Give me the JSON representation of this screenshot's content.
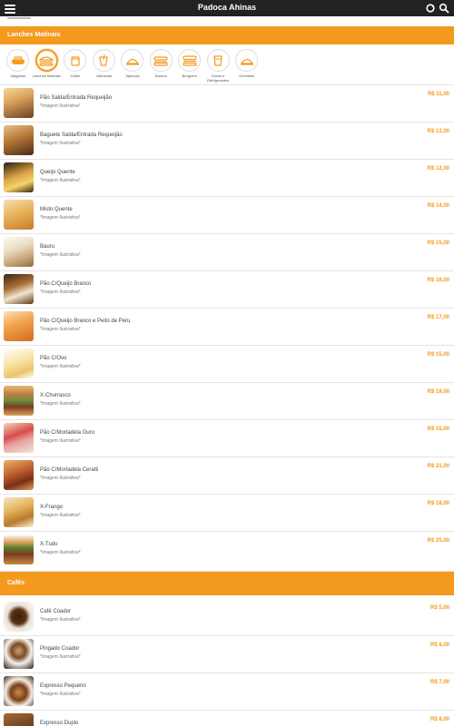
{
  "app": {
    "title": "Padoca Ahinas"
  },
  "sections": [
    {
      "title": "Lanches Matinais"
    },
    {
      "title": "Cafés"
    }
  ],
  "categories": [
    {
      "label": "Salgados",
      "icon": "bread-icon"
    },
    {
      "label": "Lanches Matinais",
      "icon": "sandwich-icon"
    },
    {
      "label": "Cafés",
      "icon": "coffee-cup-icon"
    },
    {
      "label": "Vitaminas",
      "icon": "smoothie-icon"
    },
    {
      "label": "Tapiocas",
      "icon": "cloche-icon"
    },
    {
      "label": "Baurus",
      "icon": "sandwich-icon"
    },
    {
      "label": "Burguers",
      "icon": "burger-icon"
    },
    {
      "label": "Sucos e Refrigerantes",
      "icon": "cup-icon"
    },
    {
      "label": "Omeletes",
      "icon": "cloche-icon"
    }
  ],
  "items": [
    {
      "name": "Pão Salda/Entrada Requeijão",
      "note": "*Imagem Ilustrativa*",
      "price": "R$ 11,00"
    },
    {
      "name": "Baguete Salda/Entrada Requeijão",
      "note": "*Imagem Ilustrativa*",
      "price": "R$ 13,00"
    },
    {
      "name": "Queijo Quente",
      "note": "*Imagem Ilustrativa*",
      "price": "R$ 12,00"
    },
    {
      "name": "Misto Quente",
      "note": "*Imagem Ilustrativa*",
      "price": "R$ 14,00"
    },
    {
      "name": "Bauru",
      "note": "*Imagem Ilustrativa*",
      "price": "R$ 15,00"
    },
    {
      "name": "Pão C/Queijo Branco",
      "note": "*Imagem Ilustrativa*",
      "price": "R$ 16,00"
    },
    {
      "name": "Pão C/Queijo Branco e Peito de Peru",
      "note": "*Imagem Ilustrativa*",
      "price": "R$ 17,00"
    },
    {
      "name": "Pão C/Ovo",
      "note": "*Imagem Ilustrativa*",
      "price": "R$ 15,00"
    },
    {
      "name": "X-Churrasco",
      "note": "*Imagem Ilustrativa*",
      "price": "R$ 19,00"
    },
    {
      "name": "Pão C/Mortadela Ouro",
      "note": "*Imagem Ilustrativa*",
      "price": "R$ 15,00"
    },
    {
      "name": "Pão C/Mortadela Ceratti",
      "note": "*Imagem Ilustrativa*",
      "price": "R$ 21,00"
    },
    {
      "name": "X-Frango",
      "note": "*Imagem Ilustrativa*",
      "price": "R$ 18,00"
    },
    {
      "name": "X-Tudo",
      "note": "*Imagem Ilustrativa*",
      "price": "R$ 25,00"
    }
  ],
  "cafes": [
    {
      "name": "Café Coador",
      "note": "*Imagem Ilustrativa*",
      "price": "R$ 5,00"
    },
    {
      "name": "Pingado Coador",
      "note": "*Imagem Ilustrativa*",
      "price": "R$ 6,00"
    },
    {
      "name": "Expresso Pequeno",
      "note": "*Imagem Ilustrativa*",
      "price": "R$ 7,00"
    },
    {
      "name": "Expresso Duplo",
      "note": "",
      "price": "R$ 8,00"
    }
  ],
  "colors": {
    "accent": "#f39a1f",
    "topbar": "#222222"
  }
}
